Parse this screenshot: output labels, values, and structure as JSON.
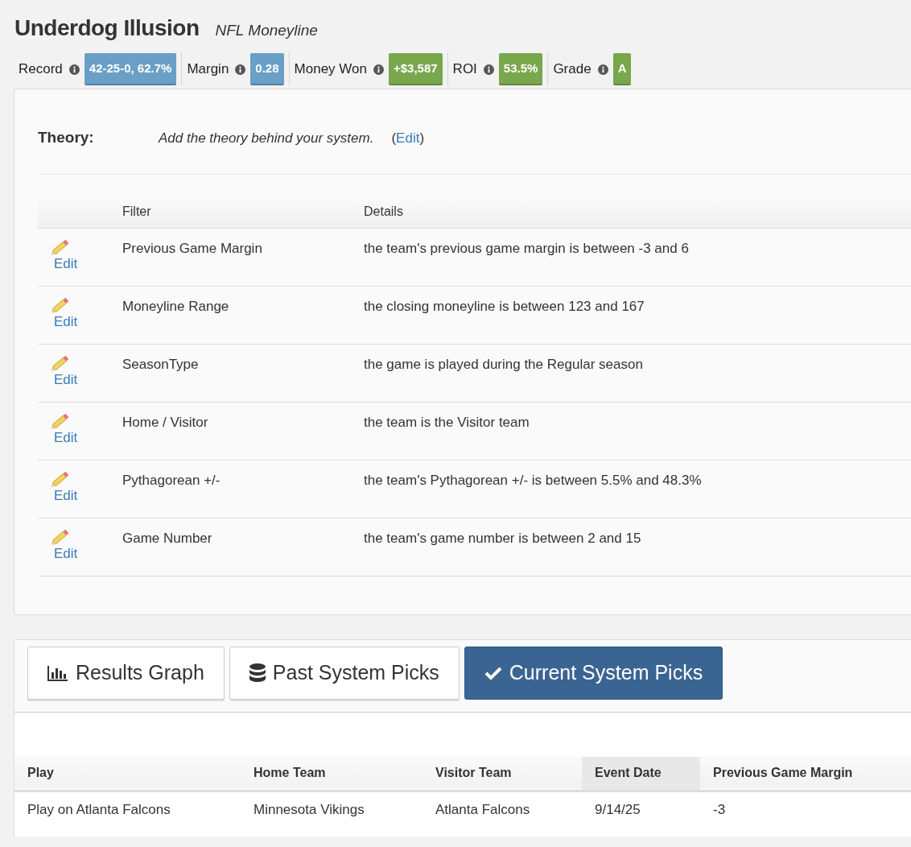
{
  "title": "Underdog Illusion",
  "subtitle": "NFL Moneyline",
  "stats": [
    {
      "label": "Record",
      "value": "42-25-0, 62.7%",
      "color": "#6a9fc6"
    },
    {
      "label": "Margin",
      "value": "0.28",
      "color": "#6a9fc6"
    },
    {
      "label": "Money Won",
      "value": "+$3,587",
      "color": "#79a74c"
    },
    {
      "label": "ROI",
      "value": "53.5%",
      "color": "#79a74c"
    },
    {
      "label": "Grade",
      "value": "A",
      "color": "#79a74c"
    }
  ],
  "theory": {
    "label": "Theory:",
    "text": "Add the theory behind your system.",
    "edit_open": "(",
    "edit_link": "Edit",
    "edit_close": ")"
  },
  "filters": {
    "columns": [
      "Filter",
      "Details"
    ],
    "rows": [
      {
        "edit": "Edit",
        "filter": "Previous Game Margin",
        "details": "the team's previous game margin is between -3 and 6"
      },
      {
        "edit": "Edit",
        "filter": "Moneyline Range",
        "details": "the closing moneyline is between 123 and 167"
      },
      {
        "edit": "Edit",
        "filter": "SeasonType",
        "details": "the game is played during the Regular season"
      },
      {
        "edit": "Edit",
        "filter": "Home / Visitor",
        "details": "the team is the Visitor team"
      },
      {
        "edit": "Edit",
        "filter": "Pythagorean +/-",
        "details": "the team's Pythagorean +/- is between 5.5% and 48.3%"
      },
      {
        "edit": "Edit",
        "filter": "Game Number",
        "details": "the team's game number is between 2 and 15"
      }
    ]
  },
  "tabs": [
    {
      "label": "Results Graph",
      "kind": "chart",
      "selected": false
    },
    {
      "label": "Past System Picks",
      "kind": "database",
      "selected": false
    },
    {
      "label": "Current System Picks",
      "kind": "check",
      "selected": true
    }
  ],
  "picks": {
    "columns": [
      {
        "label": "Play",
        "sorted": false
      },
      {
        "label": "Home Team",
        "sorted": false
      },
      {
        "label": "Visitor Team",
        "sorted": false
      },
      {
        "label": "Event Date",
        "sorted": true
      },
      {
        "label": "Previous Game Margin",
        "sorted": false
      }
    ],
    "rows": [
      [
        "Play on Atlanta Falcons",
        "Minnesota Vikings",
        "Atlanta Falcons",
        "9/14/25",
        "-3"
      ]
    ]
  }
}
